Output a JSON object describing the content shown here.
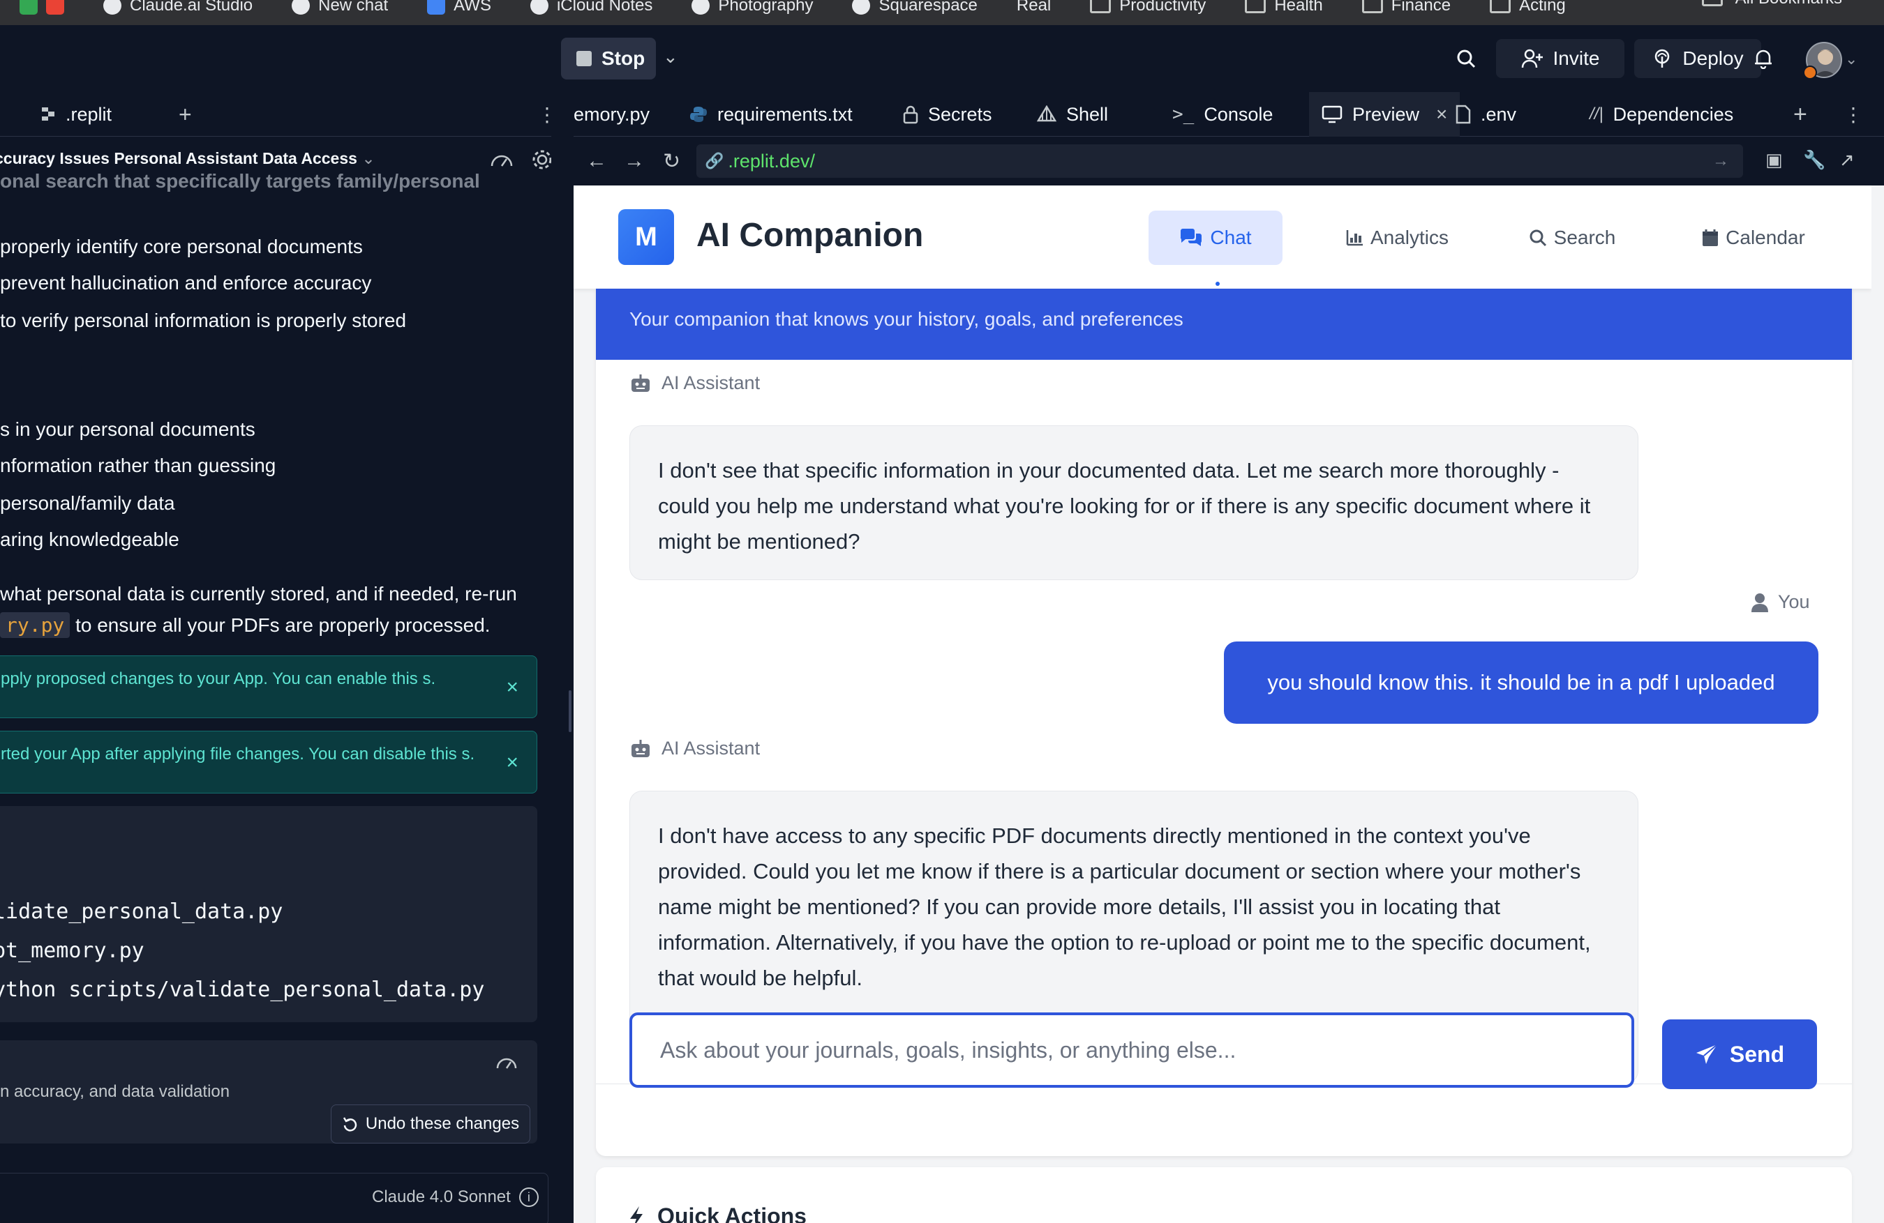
{
  "bookmarks": {
    "items": [
      "Claude.ai Studio",
      "New chat",
      "AWS",
      "iCloud Notes",
      "Photography",
      "Squarespace",
      "Real",
      "Productivity",
      "Health",
      "Finance",
      "Acting"
    ],
    "all_bookmarks": "All Bookmarks"
  },
  "topbar": {
    "stop_label": "Stop",
    "invite_label": "Invite",
    "deploy_label": "Deploy"
  },
  "left_pane": {
    "tabs": [
      ".replit"
    ],
    "title": "ccuracy Issues Personal Assistant Data Access",
    "lines": [
      "onal search that specifically targets family/personal",
      "properly identify core personal documents",
      " prevent hallucination and enforce accuracy",
      " to verify personal information is properly stored",
      "s in your personal documents",
      "nformation rather than guessing",
      "personal/family data",
      "aring knowledgeable",
      " what personal data is currently stored, and if needed, re-run",
      " to ensure all your PDFs are properly processed."
    ],
    "inline_code": "ry.py",
    "notices": [
      "pply proposed changes to your App. You can enable this s.",
      "rted your App after applying file changes. You can disable this s."
    ],
    "code_lines": [
      "lidate_personal_data.py",
      "pt_memory.py",
      "ython scripts/validate_personal_data.py"
    ],
    "summary_text": "n accuracy, and data validation",
    "undo_label": "Undo these changes",
    "model_label": "Claude 4.0 Sonnet"
  },
  "right_tabs": {
    "items": [
      "emory.py",
      "requirements.txt",
      "Secrets",
      "Shell",
      "Console",
      "Preview",
      ".env",
      "Dependencies"
    ],
    "url": ".replit.dev/"
  },
  "app": {
    "logo_letter": "M",
    "title": "AI Companion",
    "nav": [
      "Chat",
      "Analytics",
      "Search",
      "Calendar"
    ],
    "banner_text": "Your companion that knows your history, goals, and preferences",
    "assistant_label": "AI Assistant",
    "user_label": "You",
    "messages": [
      "I don't see that specific information in your documented data. Let me search more thoroughly - could you help me understand what you're looking for or if there is any specific document where it might be mentioned?",
      "you should know this. it should be in a pdf I uploaded",
      "I don't have access to any specific PDF documents directly mentioned in the context you've provided. Could you let me know if there is a particular document or section where your mother's name might be mentioned? If you can provide more details, I'll assist you in locating that information. Alternatively, if you have the option to re-upload or point me to the specific document, that would be helpful."
    ],
    "input_placeholder": "Ask about your journals, goals, insights, or anything else...",
    "send_label": "Send",
    "quick_actions_title": "Quick Actions"
  }
}
